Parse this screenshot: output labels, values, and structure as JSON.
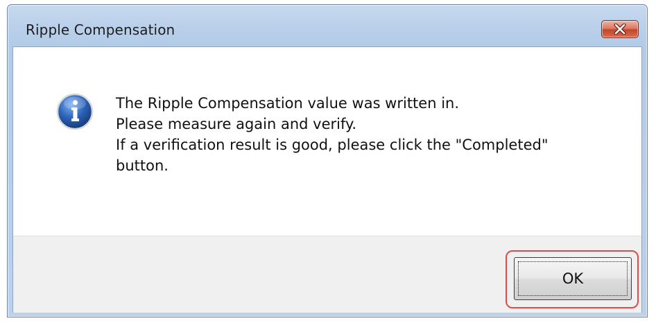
{
  "window": {
    "title": "Ripple Compensation"
  },
  "icons": {
    "message_icon": "info-icon",
    "close_icon": "close-icon"
  },
  "message": {
    "lines": [
      "The Ripple Compensation value was written in.",
      "Please measure again and verify.",
      "If a verification result is good, please click the \"Completed\"",
      "button."
    ]
  },
  "buttons": {
    "ok_label": "OK"
  },
  "colors": {
    "titlebar": "#bad0ea",
    "close_button": "#c2452c",
    "highlight": "#e04a4a",
    "info_icon": "#2c63b8"
  }
}
